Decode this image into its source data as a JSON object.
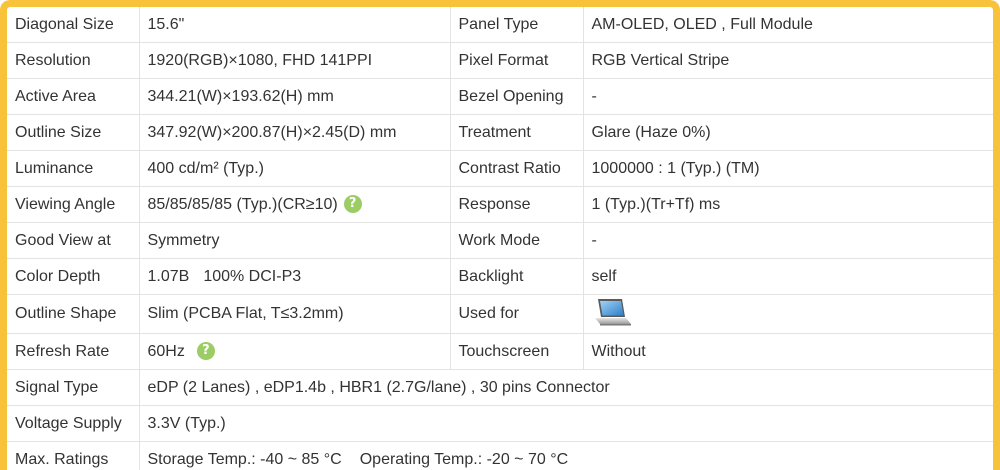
{
  "specs": {
    "diagonal_size": {
      "label": "Diagonal Size",
      "value": "15.6\""
    },
    "panel_type": {
      "label": "Panel Type",
      "value": "AM-OLED, OLED , Full Module"
    },
    "resolution": {
      "label": "Resolution",
      "value": "1920(RGB)×1080, FHD  141PPI"
    },
    "pixel_format": {
      "label": "Pixel Format",
      "value": "RGB Vertical Stripe"
    },
    "active_area": {
      "label": "Active Area",
      "value": "344.21(W)×193.62(H) mm"
    },
    "bezel_opening": {
      "label": "Bezel Opening",
      "value": "-"
    },
    "outline_size": {
      "label": "Outline Size",
      "value": "347.92(W)×200.87(H)×2.45(D) mm"
    },
    "treatment": {
      "label": "Treatment",
      "value": "Glare (Haze 0%)"
    },
    "luminance": {
      "label": "Luminance",
      "value": "400 cd/m² (Typ.)"
    },
    "contrast_ratio": {
      "label": "Contrast Ratio",
      "value": "1000000 : 1 (Typ.) (TM)"
    },
    "viewing_angle": {
      "label": "Viewing Angle",
      "value": "85/85/85/85 (Typ.)(CR≥10)"
    },
    "response": {
      "label": "Response",
      "value": "1 (Typ.)(Tr+Tf) ms"
    },
    "good_view_at": {
      "label": "Good View at",
      "value": "Symmetry"
    },
    "work_mode": {
      "label": "Work Mode",
      "value": "-"
    },
    "color_depth": {
      "label": "Color Depth",
      "value_a": "1.07B",
      "value_b": "100% DCI-P3"
    },
    "backlight": {
      "label": "Backlight",
      "value": "self"
    },
    "outline_shape": {
      "label": "Outline Shape",
      "value": "Slim (PCBA Flat, T≤3.2mm)"
    },
    "used_for": {
      "label": "Used for",
      "icon": "laptop-icon"
    },
    "refresh_rate": {
      "label": "Refresh Rate",
      "value": "60Hz"
    },
    "touchscreen": {
      "label": "Touchscreen",
      "value": "Without"
    },
    "signal_type": {
      "label": "Signal Type",
      "value": "eDP (2 Lanes) , eDP1.4b , HBR1 (2.7G/lane) , 30 pins Connector"
    },
    "voltage_supply": {
      "label": "Voltage Supply",
      "value": "3.3V (Typ.)"
    },
    "max_ratings": {
      "label": "Max. Ratings",
      "value_a": "Storage Temp.: -40 ~ 85 °C",
      "value_b": "Operating Temp.: -20 ~ 70 °C"
    }
  },
  "help_glyph": "?",
  "colors": {
    "frame_border": "#f8c23a",
    "help_badge": "#9ccc65",
    "text": "#333333",
    "grid_line": "#e3e3e3"
  }
}
